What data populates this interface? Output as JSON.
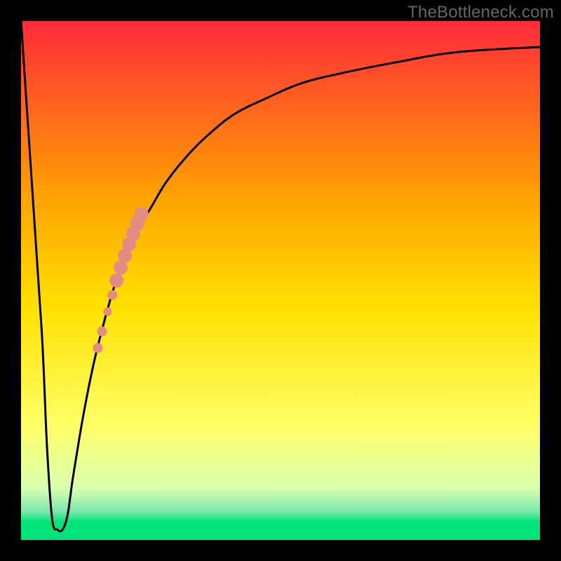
{
  "watermark": "TheBottleneck.com",
  "chart_data": {
    "type": "line",
    "title": "",
    "xlabel": "",
    "ylabel": "",
    "xlim": [
      0,
      100
    ],
    "ylim": [
      0,
      100
    ],
    "grid": false,
    "legend": false,
    "gradient_colors": {
      "top": "#ff2a3b",
      "mid_upper": "#ffa200",
      "mid": "#ffe000",
      "mid_lower": "#ffff66",
      "low": "#d9ffb0",
      "thin_band": "#7be8ae",
      "bottom": "#00e47a"
    },
    "gradient_stops": [
      {
        "offset": 0.0,
        "color": "#ff2a3b"
      },
      {
        "offset": 0.34,
        "color": "#ffa200"
      },
      {
        "offset": 0.55,
        "color": "#ffe000"
      },
      {
        "offset": 0.78,
        "color": "#ffff66"
      },
      {
        "offset": 0.9,
        "color": "#d9ffb0"
      },
      {
        "offset": 0.945,
        "color": "#7be8ae"
      },
      {
        "offset": 0.965,
        "color": "#00e47a"
      },
      {
        "offset": 1.0,
        "color": "#00e47a"
      }
    ],
    "series": [
      {
        "name": "bottleneck-curve",
        "color": "#000000",
        "x": [
          0,
          2,
          4,
          5,
          6,
          7,
          8,
          9,
          10,
          12,
          14,
          16,
          18,
          20,
          22,
          25,
          28,
          32,
          36,
          41,
          47,
          54,
          62,
          72,
          84,
          100
        ],
        "y": [
          100,
          70,
          40,
          18,
          4,
          2,
          2,
          5,
          12,
          24,
          34,
          42,
          49,
          55,
          59,
          64,
          69,
          74,
          78,
          82,
          85,
          88,
          90,
          92,
          94,
          95
        ]
      }
    ],
    "scatter": {
      "name": "highlight-band",
      "color": "#e38b85",
      "points": [
        {
          "x": 14.8,
          "y": 37.0,
          "r": 7
        },
        {
          "x": 15.6,
          "y": 40.2,
          "r": 7
        },
        {
          "x": 16.7,
          "y": 44.0,
          "r": 6
        },
        {
          "x": 17.6,
          "y": 47.2,
          "r": 7
        },
        {
          "x": 18.4,
          "y": 50.0,
          "r": 10
        },
        {
          "x": 19.2,
          "y": 52.5,
          "r": 10
        },
        {
          "x": 20.0,
          "y": 54.8,
          "r": 10
        },
        {
          "x": 20.8,
          "y": 57.0,
          "r": 10
        },
        {
          "x": 21.6,
          "y": 59.0,
          "r": 10
        },
        {
          "x": 22.4,
          "y": 61.0,
          "r": 10
        },
        {
          "x": 23.2,
          "y": 62.8,
          "r": 10
        }
      ]
    }
  }
}
